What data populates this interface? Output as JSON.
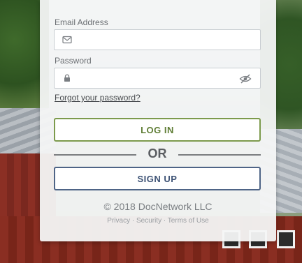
{
  "login": {
    "email_label": "Email Address",
    "email_value": "",
    "password_label": "Password",
    "password_value": "",
    "forgot_link": "Forgot your password?",
    "login_button": "LOG IN",
    "or_divider": "OR",
    "signup_button": "SIGN UP"
  },
  "footer": {
    "copyright": "© 2018 DocNetwork LLC",
    "links": "Privacy · Security · Terms of Use"
  },
  "icons": {
    "email": "envelope-icon",
    "password": "lock-icon",
    "toggle_visibility": "eye-slash-icon"
  },
  "colors": {
    "login_border": "#7c9a4c",
    "login_text": "#5f7d35",
    "signup_border": "#4e6486",
    "signup_text": "#3d5275"
  }
}
